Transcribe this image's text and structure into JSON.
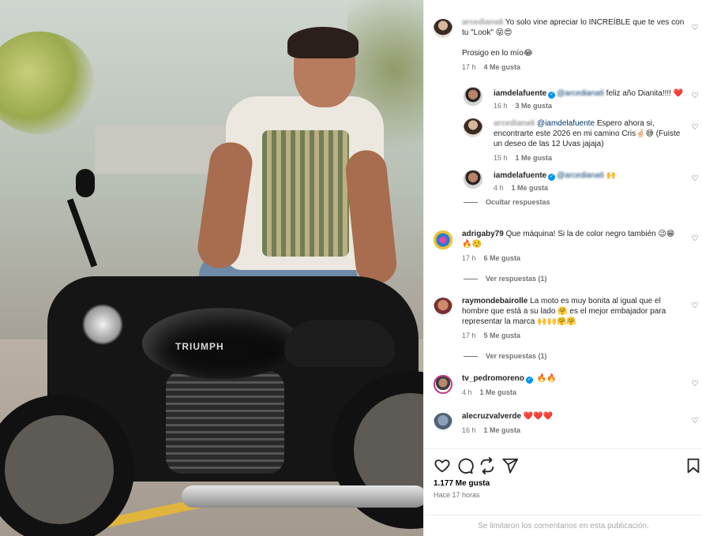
{
  "post_image": {
    "brand_text": "TRIUMPH"
  },
  "comments": [
    {
      "user": "arcediana6",
      "text_a": "Yo solo vine apreciar lo INCREÍBLE que te ves con",
      "text_b": "tu \"Look\" 😝😍",
      "text_c": "Prosigo en lo mío😂",
      "time": "17 h",
      "likes": "4 Me gusta"
    },
    {
      "user": "iamdelafuente",
      "mention": "@arcediana6",
      "text": "feliz año Dianita!!!! ❤️",
      "time": "16 h",
      "likes": "3 Me gusta"
    },
    {
      "user": "arcediana6",
      "mention": "@iamdelafuente",
      "text_a": "Espero ahora si,",
      "text_b": "encontrarte este 2026 en mi camino Cris🤞🏻😅 (Fuiste",
      "text_c": "un deseo de las 12 Uvas jajaja)",
      "time": "15 h",
      "likes": "1 Me gusta"
    },
    {
      "user": "iamdelafuente",
      "mention": "@arcediana6",
      "text": "🙌",
      "time": "4 h",
      "likes": "1 Me gusta"
    },
    {
      "user": "adrigaby79",
      "text_a": "Que máquina! Si la de color negro también 😉😁",
      "text_b": "🔥☺️",
      "time": "17 h",
      "likes": "6 Me gusta"
    },
    {
      "user": "raymondebairolle",
      "text_a": "La moto es muy bonita al igual que el",
      "text_b": "hombre que está a su lado 🤗 es el mejor embajador para",
      "text_c": "representar la marca 🙌🙌🤗🤗",
      "time": "17 h",
      "likes": "5 Me gusta"
    },
    {
      "user": "tv_pedromoreno",
      "text": "🔥🔥",
      "time": "4 h",
      "likes": "1 Me gusta"
    },
    {
      "user": "alecruzvalverde",
      "text": "❤️❤️❤️",
      "time": "16 h",
      "likes": "1 Me gusta"
    }
  ],
  "hide_replies": "Ocultar respuestas",
  "view_replies": "Ver respuestas (1)",
  "footer": {
    "likes": "1.177 Me gusta",
    "time_ago": "Hace 17 horas",
    "comments_closed": "Se limitaron los comentarios en esta publicación."
  },
  "icons": [
    "heart-icon",
    "comment-icon",
    "share-icon",
    "send-icon",
    "bookmark-icon",
    "verified-badge-icon"
  ]
}
